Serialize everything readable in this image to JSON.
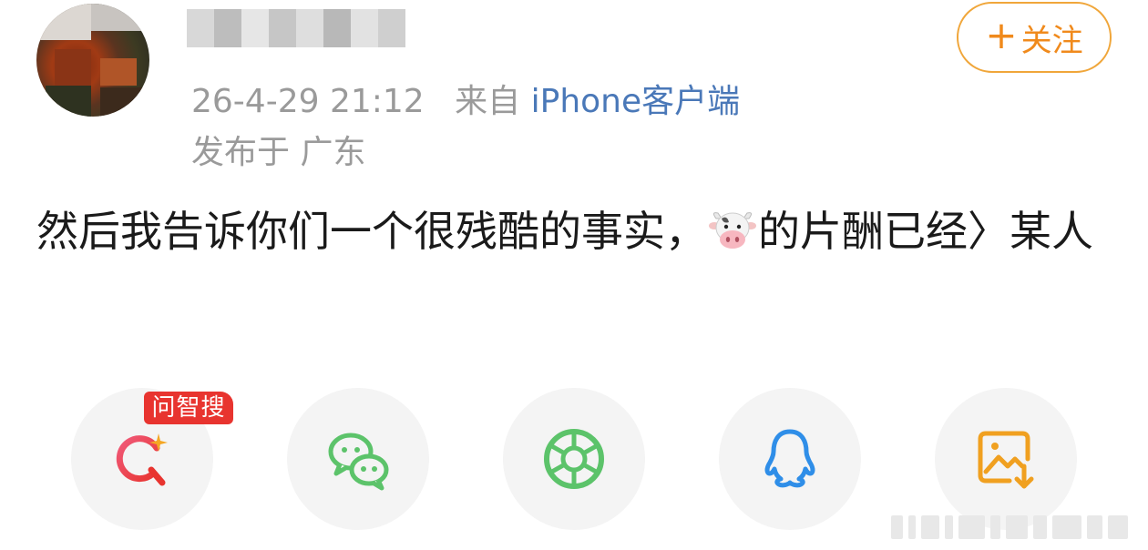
{
  "post": {
    "timestamp": "26-4-29 21:12",
    "source_prefix": "来自",
    "source_device": "iPhone客户端",
    "location": "发布于 广东",
    "text_before_emoji": "然后我告诉你们一个很残酷的事实，",
    "emoji": "cow-face-icon",
    "text_after_emoji": "的片酬已经〉某人"
  },
  "follow": {
    "plus": "+",
    "label": "关注"
  },
  "share": {
    "badge": "问智搜",
    "buttons": [
      {
        "icon": "ai-search-icon",
        "color": "#e8342f"
      },
      {
        "icon": "wechat-icon",
        "color": "#5cc36a"
      },
      {
        "icon": "moments-icon",
        "color": "#5cc36a"
      },
      {
        "icon": "qq-icon",
        "color": "#2f8ee8"
      },
      {
        "icon": "save-image-icon",
        "color": "#f0a020"
      }
    ]
  }
}
